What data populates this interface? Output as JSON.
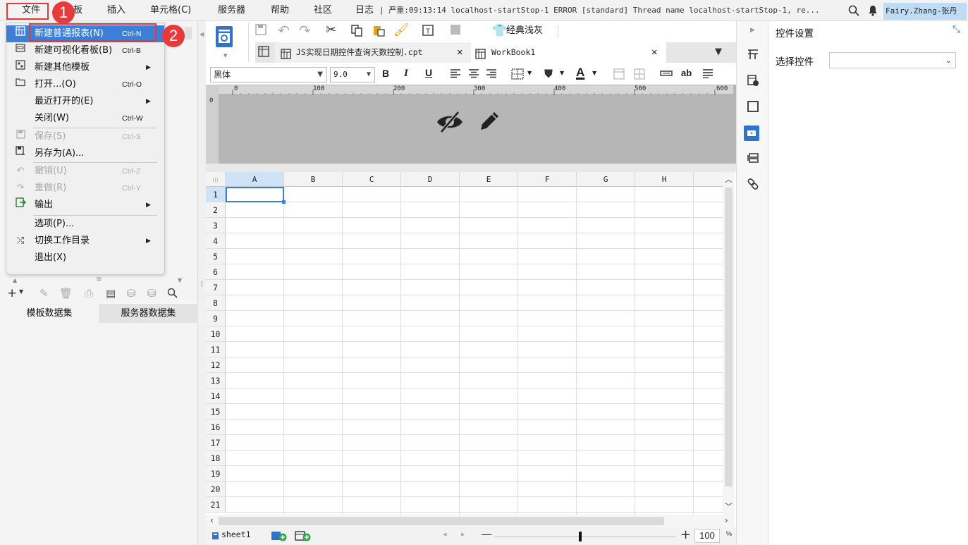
{
  "menubar": {
    "items": [
      "文件",
      "板",
      "插入",
      "单元格(C)",
      "服务器",
      "帮助",
      "社区"
    ],
    "log_label": "日志",
    "log_text": "| 严重:09:13:14 localhost-startStop-1 ERROR [standard] Thread name localhost-startStop-1, re...",
    "user": "Fairy.Zhang-张丹"
  },
  "badges": [
    "1",
    "2"
  ],
  "file_menu": [
    {
      "icon": "new-report-icon",
      "label": "新建普通报表(N)",
      "shortcut": "Ctrl-N",
      "state": "selected"
    },
    {
      "icon": "dashboard-icon",
      "label": "新建可视化看板(B)",
      "shortcut": "Ctrl-B",
      "state": "normal"
    },
    {
      "icon": "template-icon",
      "label": "新建其他模板",
      "shortcut": "",
      "state": "normal",
      "submenu": true
    },
    {
      "icon": "open-folder-icon",
      "label": "打开...(O)",
      "shortcut": "Ctrl-O",
      "state": "normal"
    },
    {
      "icon": "",
      "label": "最近打开的(E)",
      "shortcut": "",
      "state": "normal",
      "submenu": true
    },
    {
      "icon": "",
      "label": "关闭(W)",
      "shortcut": "Ctrl-W",
      "state": "normal"
    },
    {
      "icon": "save-icon",
      "label": "保存(S)",
      "shortcut": "Ctrl-S",
      "state": "disabled"
    },
    {
      "icon": "save-as-icon",
      "label": "另存为(A)...",
      "shortcut": "",
      "state": "normal"
    },
    {
      "icon": "undo-icon",
      "label": "撤销(U)",
      "shortcut": "Ctrl-Z",
      "state": "disabled"
    },
    {
      "icon": "redo-icon",
      "label": "重做(R)",
      "shortcut": "Ctrl-Y",
      "state": "disabled"
    },
    {
      "icon": "export-icon",
      "label": "输出",
      "shortcut": "",
      "state": "normal",
      "submenu": true
    },
    {
      "icon": "",
      "label": "选项(P)...",
      "shortcut": "",
      "state": "normal"
    },
    {
      "icon": "switch-icon",
      "label": "切换工作目录",
      "shortcut": "",
      "state": "normal",
      "submenu": true
    },
    {
      "icon": "",
      "label": "退出(X)",
      "shortcut": "",
      "state": "normal"
    }
  ],
  "dataset_tabs": [
    "模板数据集",
    "服务器数据集"
  ],
  "toolbar": {
    "theme_label": "经典浅灰"
  },
  "tabs": [
    {
      "label": "JS实现日期控件查询天数控制.cpt",
      "active": false
    },
    {
      "label": "WorkBook1",
      "active": true
    }
  ],
  "font": {
    "name": "黑体",
    "size": "9.0"
  },
  "ruler_ticks": [
    "0",
    "100",
    "200",
    "300",
    "400",
    "500",
    "600"
  ],
  "columns": [
    "A",
    "B",
    "C",
    "D",
    "E",
    "F",
    "G",
    "H"
  ],
  "rows": [
    "1",
    "2",
    "3",
    "4",
    "5",
    "6",
    "7",
    "8",
    "9",
    "10",
    "11",
    "12",
    "13",
    "14",
    "15",
    "16",
    "17",
    "18",
    "19",
    "20",
    "21"
  ],
  "sheet": {
    "name": "sheet1",
    "zoom": "100",
    "zoom_unit": "%"
  },
  "right_panel": {
    "title": "控件设置",
    "select_label": "选择控件",
    "select_value": ""
  },
  "colors": {
    "selected": "#3d7fd6",
    "highlight_box": "#e5383b",
    "user_bg": "#bfdcf5"
  }
}
